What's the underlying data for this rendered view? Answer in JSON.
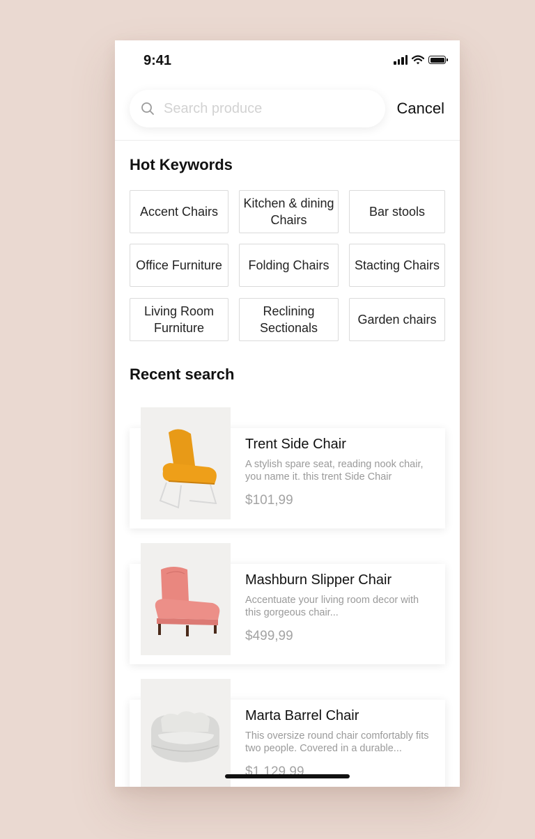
{
  "status_bar": {
    "time": "9:41"
  },
  "search": {
    "placeholder": "Search produce",
    "cancel_label": "Cancel"
  },
  "hot_keywords": {
    "title": "Hot Keywords",
    "items": [
      "Accent Chairs",
      "Kitchen & dining Chairs",
      "Bar stools",
      "Office Furniture",
      "Folding Chairs",
      "Stacting Chairs",
      "Living Room Furniture",
      "Reclining Sectionals",
      "Garden chairs"
    ]
  },
  "recent": {
    "title": "Recent search",
    "items": [
      {
        "name": "Trent Side Chair",
        "description": "A stylish spare seat, reading nook chair, you name it. this trent Side Chair",
        "price": "$101,99",
        "image": "orange-lounge-chair"
      },
      {
        "name": "Mashburn Slipper Chair",
        "description": "Accentuate your living room decor with this gorgeous chair...",
        "price": "$499,99",
        "image": "pink-slipper-chair"
      },
      {
        "name": "Marta Barrel Chair",
        "description": "This oversize round chair comfortably fits two people. Covered in a durable...",
        "price": "$1,129,99",
        "image": "grey-barrel-chair"
      }
    ]
  },
  "colors": {
    "background": "#ead9d1",
    "card": "#ffffff",
    "thumb_bg": "#f1f0ee"
  }
}
